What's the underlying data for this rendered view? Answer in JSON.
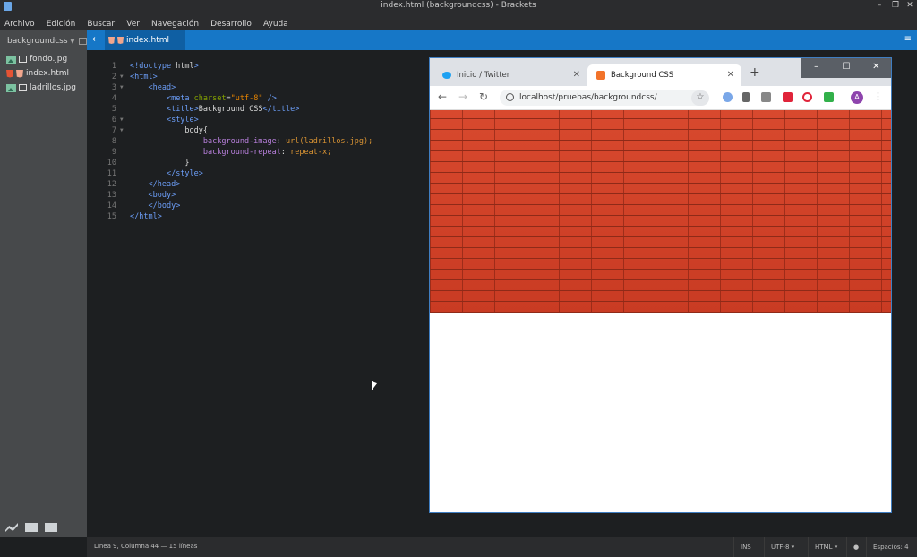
{
  "window": {
    "title": "index.html (backgroundcss) - Brackets"
  },
  "menu": [
    "Archivo",
    "Edición",
    "Buscar",
    "Ver",
    "Navegación",
    "Desarrollo",
    "Ayuda"
  ],
  "sidebar": {
    "project": "backgroundcss",
    "files": [
      {
        "name": "fondo.jpg",
        "icon": "image-icon"
      },
      {
        "name": "index.html",
        "icon": "html5-icon"
      },
      {
        "name": "ladrillos.jpg",
        "icon": "image-icon"
      }
    ]
  },
  "tab": {
    "label": "index.html"
  },
  "editor": {
    "line_numbers": [
      "1",
      "2",
      "3",
      "4",
      "5",
      "6",
      "7",
      "8",
      "9",
      "10",
      "11",
      "12",
      "13",
      "14",
      "15"
    ],
    "lines": [
      "<!doctype html>",
      "<html>",
      "    <head>",
      "        <meta charset=\"utf-8\" />",
      "        <title>Background CSS</title>",
      "        <style>",
      "            body{",
      "                background-image: url(ladrillos.jpg);",
      "                background-repeat: repeat-x;",
      "            }",
      "        </style>",
      "    </head>",
      "    <body>",
      "    </body>",
      "</html>"
    ]
  },
  "browser": {
    "tabs": [
      {
        "label": "Inicio / Twitter",
        "active": false
      },
      {
        "label": "Background CSS",
        "active": true
      }
    ],
    "url": "localhost/pruebas/backgroundcss/",
    "profile_initial": "A"
  },
  "status": {
    "position": "Línea 9, Columna 44 — 15 líneas",
    "mode": "INS",
    "encoding": "UTF-8",
    "language": "HTML",
    "indent": "Espacios: 4"
  },
  "colors": {
    "accent": "#1677c7",
    "brick": "#d0432a"
  }
}
